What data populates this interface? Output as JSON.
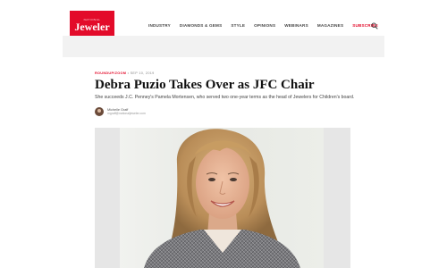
{
  "header": {
    "logo": {
      "super": "National",
      "word": "Jeweler"
    },
    "nav": [
      {
        "label": "INDUSTRY"
      },
      {
        "label": "DIAMONDS & GEMS"
      },
      {
        "label": "STYLE"
      },
      {
        "label": "OPINIONS"
      },
      {
        "label": "WEBINARS"
      },
      {
        "label": "MAGAZINES"
      },
      {
        "label": "SUBSCRIBE",
        "accent": true
      }
    ],
    "search_icon": "search-icon"
  },
  "article": {
    "category": "ROUNDUP/ZOOM",
    "date": "SEP 10, 2019",
    "title": "Debra Puzio Takes Over as JFC Chair",
    "dek": "She succeeds J.C. Penney's Pamela Mortensen, who served two one-year terms as the head of Jewelers for Children's board.",
    "author": {
      "name": "Michelle Graff",
      "email": "mgraff@nationaljeweler.com"
    }
  },
  "colors": {
    "brand": "#e30b2a",
    "ad_band": "#f2f2f2"
  }
}
